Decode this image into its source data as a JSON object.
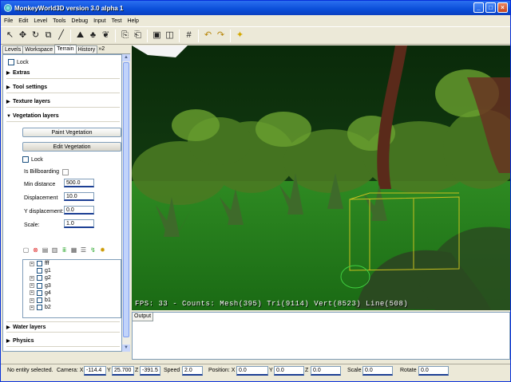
{
  "window": {
    "title": "MonkeyWorld3D version 3.0 alpha 1",
    "min": "_",
    "max": "□",
    "close": "×"
  },
  "menu": [
    "File",
    "Edit",
    "Level",
    "Tools",
    "Debug",
    "Input",
    "Test",
    "Help"
  ],
  "toolbar_icons": [
    "select-icon",
    "move-icon",
    "rotate-icon",
    "scale-icon",
    "pen-icon",
    "terrain-paint-icon",
    "tree-icon",
    "vegetation-icon",
    "copy-icon",
    "paste-icon",
    "view-icon",
    "view-alt-icon",
    "grid-icon",
    "undo-icon",
    "redo-icon",
    "light-icon"
  ],
  "tabs": [
    "Levels",
    "Workspace",
    "Terrain",
    "History",
    "»2"
  ],
  "panel": {
    "lock_label": "Lock",
    "sections": {
      "extras": "Extras",
      "tool_settings": "Tool settings",
      "texture_layers": "Texture layers",
      "vegetation_layers": "Vegetation layers",
      "water_layers": "Water layers",
      "physics": "Physics"
    },
    "paint_button": "Paint Vegetation",
    "edit_button": "Edit Vegetation",
    "veg_lock": "Lock",
    "billboarding": "Is Billboarding",
    "fields": [
      {
        "label": "Min distance",
        "value": "500.0"
      },
      {
        "label": "Displacement",
        "value": "10.0"
      },
      {
        "label": "Y displacement:",
        "value": "0.0"
      },
      {
        "label": "Scale:",
        "value": "1.0"
      }
    ],
    "tree_items": [
      {
        "label": "fff",
        "expand": true
      },
      {
        "label": "g1",
        "expand": false
      },
      {
        "label": "g2",
        "expand": true
      },
      {
        "label": "g3",
        "expand": true
      },
      {
        "label": "g4",
        "expand": true
      },
      {
        "label": "b1",
        "expand": true
      },
      {
        "label": "b2",
        "expand": true
      }
    ]
  },
  "viewport": {
    "hud": "FPS: 33 - Counts: Mesh(395) Tri(9114) Vert(8523) Line(508)"
  },
  "output": {
    "tab": "Output"
  },
  "status": {
    "message": "No entity selected.",
    "camera_label": "Camera: X",
    "cam_x": "-114.4",
    "y_label": "Y",
    "cam_y": "25.700",
    "z_label": "Z",
    "cam_z": "-391.5",
    "speed_label": "Speed",
    "speed": "2.0",
    "pos_label": "Position: X",
    "pos_x": "0.0",
    "pos_y_label": "Y",
    "pos_y": "0.0",
    "pos_z_label": "Z",
    "pos_z": "0.0",
    "scale_label": "Scale",
    "scale": "0.0",
    "rotate_label": "Rotate",
    "rotate": "0.0"
  }
}
